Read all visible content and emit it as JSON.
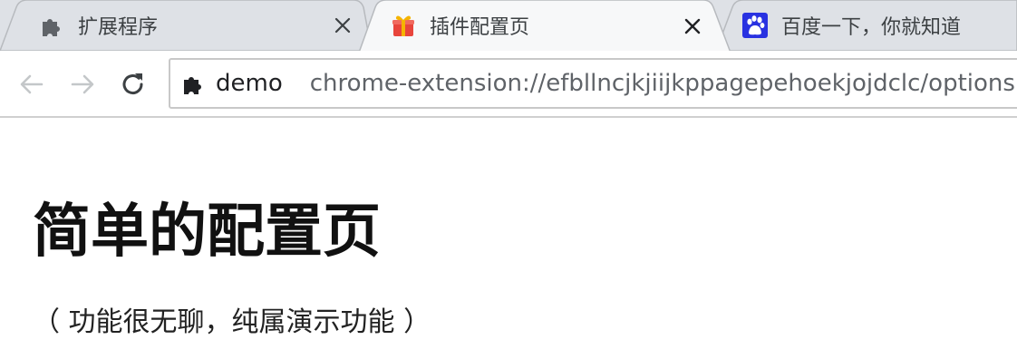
{
  "tabs": [
    {
      "title": "扩展程序",
      "icon": "puzzle-icon",
      "active": false
    },
    {
      "title": "插件配置页",
      "icon": "gift-icon",
      "active": true
    },
    {
      "title": "百度一下，你就知道",
      "icon": "baidu-paw-icon",
      "active": false
    }
  ],
  "toolbar": {
    "back_icon": "back-arrow-icon",
    "forward_icon": "forward-arrow-icon",
    "reload_icon": "reload-icon"
  },
  "omnibox": {
    "icon": "puzzle-icon",
    "label": "demo",
    "url": "chrome-extension://efbllncjkjiijkppagepehoekjojdclc/options.html"
  },
  "page": {
    "heading": "简单的配置页",
    "subtitle": "（ 功能很无聊，纯属演示功能 ）"
  },
  "colors": {
    "tabstrip_bg": "#dee1e6",
    "active_tab_bg": "#f7f8f9",
    "baidu_blue": "#2932e1",
    "gift_red": "#e8453c",
    "gift_gold": "#f5b400"
  }
}
